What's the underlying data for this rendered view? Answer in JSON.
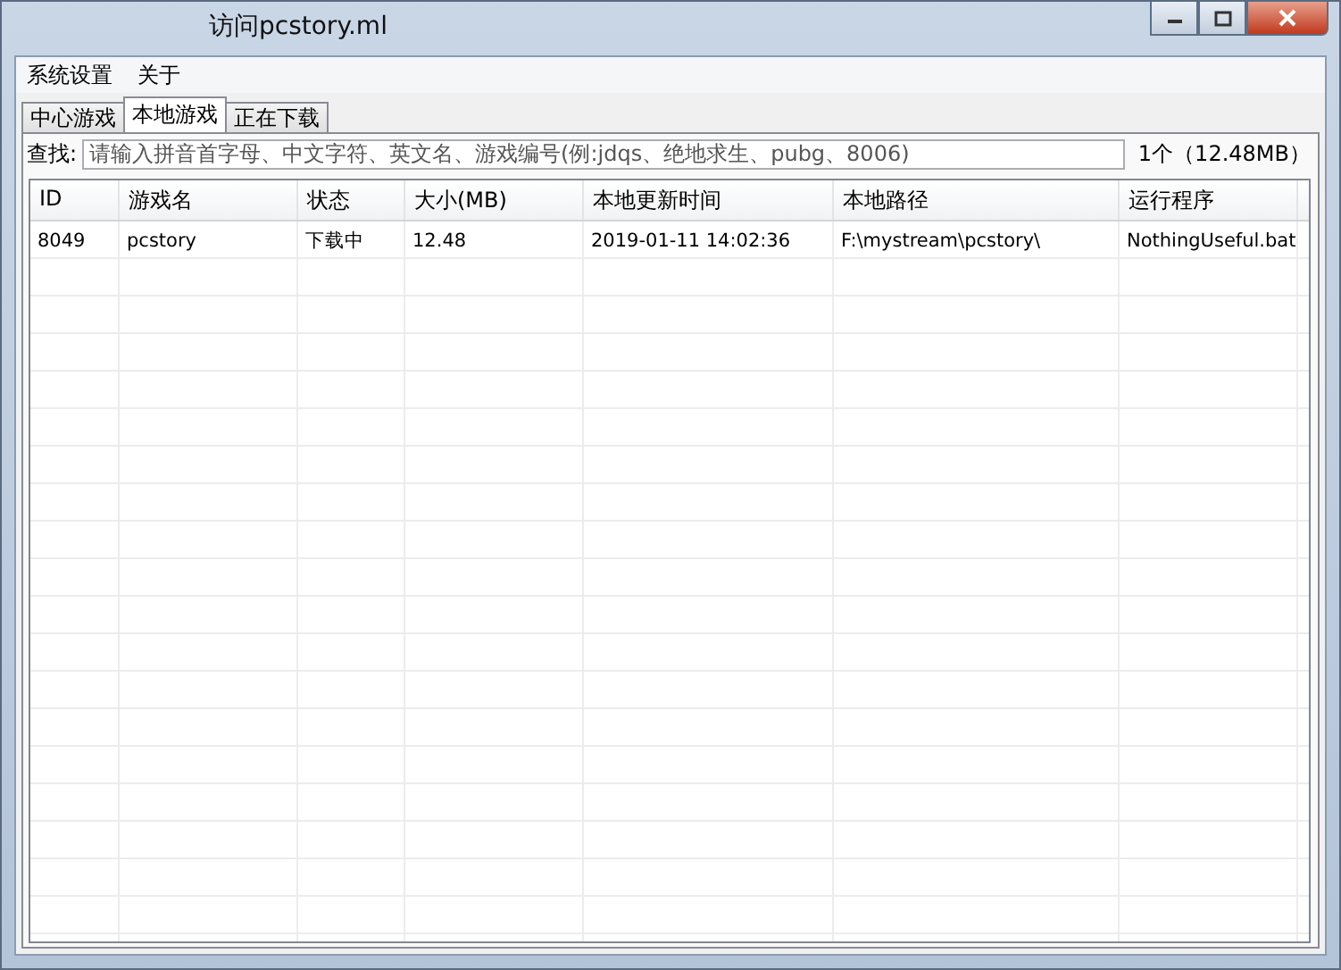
{
  "window": {
    "title": "访问pcstory.ml"
  },
  "menu": [
    "系统设置",
    "关于"
  ],
  "tabs": [
    {
      "label": "中心游戏",
      "selected": false
    },
    {
      "label": "本地游戏",
      "selected": true
    },
    {
      "label": "正在下载",
      "selected": false
    }
  ],
  "search": {
    "label": "查找:",
    "placeholder": "请输入拼音首字母、中文字符、英文名、游戏编号(例:jdqs、绝地求生、pubg、8006)",
    "summary": "1个（12.48MB）"
  },
  "table": {
    "columns": [
      "ID",
      "游戏名",
      "状态",
      "大小(MB)",
      "本地更新时间",
      "本地路径",
      "运行程序"
    ],
    "rows": [
      [
        "8049",
        "pcstory",
        "下载中",
        "12.48",
        "2019-01-11 14:02:36",
        "F:\\mystream\\pcstory\\",
        "NothingUseful.bat"
      ]
    ]
  }
}
